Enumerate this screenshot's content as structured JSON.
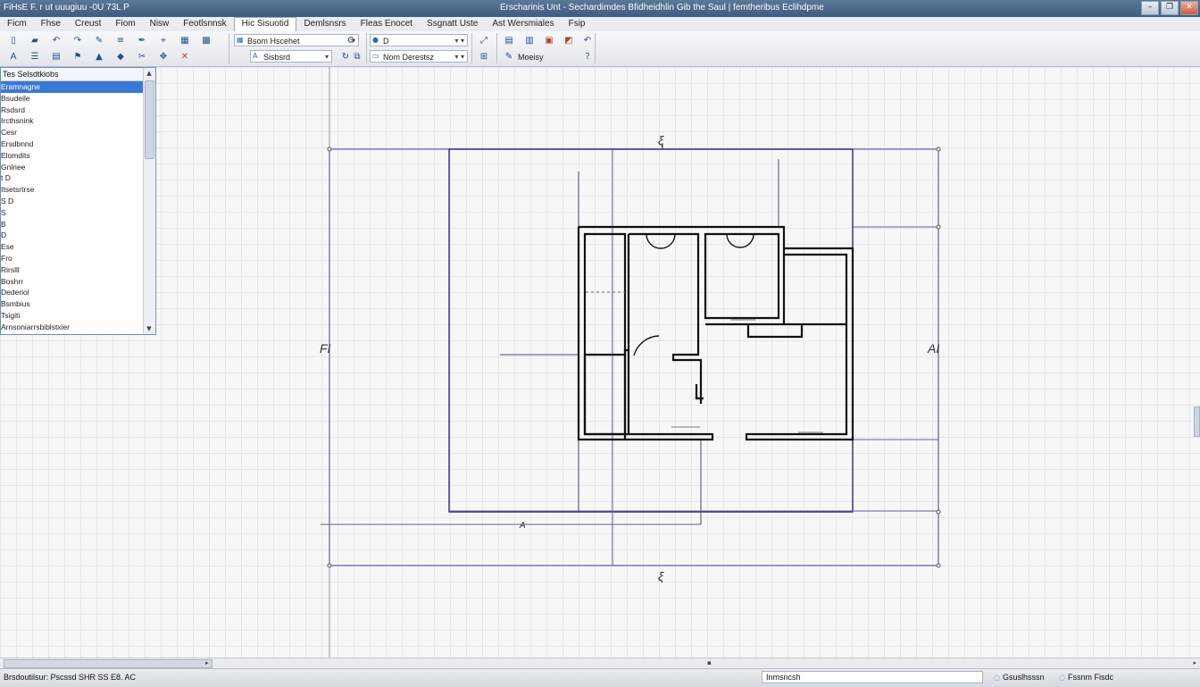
{
  "window": {
    "app_title": "FiHsE F. r ut uuugiuu -0U 73L P",
    "doc_title": "Erscharinis Unt - Sechardimdes Bfidheidhlin Gib the Saul | femtheribus Eclihdpme",
    "buttons": {
      "minimize": "–",
      "restore": "❐",
      "close": "✕"
    }
  },
  "menu": [
    "Ficm",
    "Fhse",
    "Creust",
    "Fiom",
    "Nisw",
    "Feotlsnnsk",
    "Hic Sisuotid",
    "Demlsnsrs",
    "Fleas Enocet",
    "Ssgnatt Uste",
    "Ast Wersmiales",
    "Fsip"
  ],
  "menu_active_index": 6,
  "toolbar": {
    "row1_icons": [
      "document-icon",
      "open-icon",
      "undo-icon",
      "redo-icon",
      "pencil-icon",
      "align-icon",
      "pen-icon",
      "select-icon",
      "layers-icon",
      "grid-icon"
    ],
    "row2_icons": [
      "text-icon",
      "lines-icon",
      "list-icon",
      "flag-icon",
      "paint-icon",
      "shape-icon",
      "cut-icon",
      "move-icon",
      "scissors-icon"
    ],
    "combo1": {
      "icon": "layer-icon",
      "value": "Bsom Hscehet"
    },
    "combo2": {
      "icon": "text-style-icon",
      "value": "Sisbsrd"
    },
    "combo3": {
      "icon": "color-icon",
      "value": "D"
    },
    "combo4": {
      "icon": "font-icon",
      "value": "Nom Derestsz"
    },
    "modify_label": "Moeisy",
    "right_icons": [
      "view-icon",
      "plot-icon",
      "image-icon",
      "render-icon",
      "help-icon"
    ]
  },
  "list_panel": {
    "title": "Tes Selsdtkiobs",
    "items": [
      "Eramnagne",
      "Bsudeile",
      "Rsdsrd",
      "Ircthsnink",
      "Cesr",
      "Ersdbnnd",
      "Elomdits",
      "Gnlriee",
      "t  D",
      "Itsetsrtrse",
      "S  D",
      "S",
      "B",
      "D",
      "Ese",
      "Fro",
      "Rirslll",
      "Boshrr",
      "Dederiol",
      "Bsmbius",
      "Tsigiti",
      "Arnsoniarrsbiblstxier"
    ],
    "selected_index": 0
  },
  "drawing": {
    "labels": {
      "left": "FI",
      "right": "AI",
      "top": "ξ",
      "bottom": "ξ",
      "mid": "A"
    }
  },
  "status_bar": {
    "text": "Brsdoutilsur: Pscssd SHR SS E8. AC",
    "command_field": "Inmsncsh",
    "item1": "Gsuslhsssn",
    "item2": "Fssnm Fisdc"
  }
}
